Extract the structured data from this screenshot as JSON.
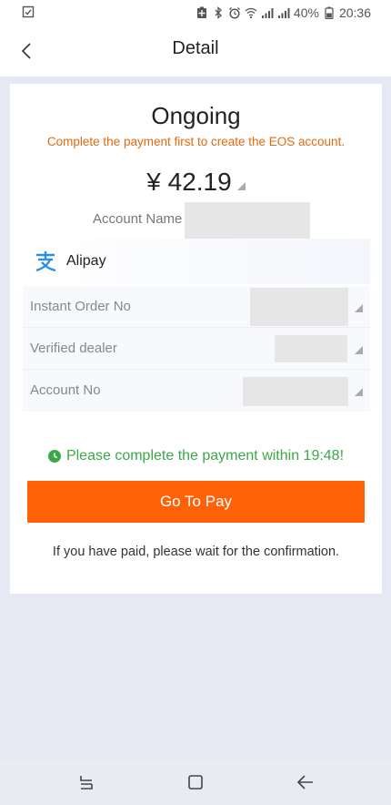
{
  "status_bar": {
    "battery": "40%",
    "time": "20:36",
    "icons": [
      "checklist-icon",
      "battery-saver-icon",
      "bluetooth-icon",
      "alarm-icon",
      "wifi-icon",
      "signal-icon",
      "signal-icon-2",
      "battery-icon"
    ]
  },
  "header": {
    "title": "Detail",
    "back_icon": "chevron-left-icon"
  },
  "order": {
    "status_title": "Ongoing",
    "status_note": "Complete the payment first to create the EOS account.",
    "amount": "¥ 42.19",
    "account_name_label": "Account Name",
    "payment_method": "Alipay",
    "details": [
      {
        "label": "Instant Order No"
      },
      {
        "label": "Verified dealer"
      },
      {
        "label": "Account No"
      }
    ],
    "timer_text": "Please complete the payment within 19:48!",
    "pay_button": "Go To Pay",
    "wait_note": "If you have paid, please wait for the confirmation."
  },
  "colors": {
    "accent": "#fd6209",
    "warning_text": "#e06a10",
    "success_text": "#3aa845",
    "page_bg": "#e6e8f3"
  },
  "nav_bar": {
    "buttons": [
      "recents-icon",
      "home-icon",
      "back-arrow-icon"
    ]
  }
}
